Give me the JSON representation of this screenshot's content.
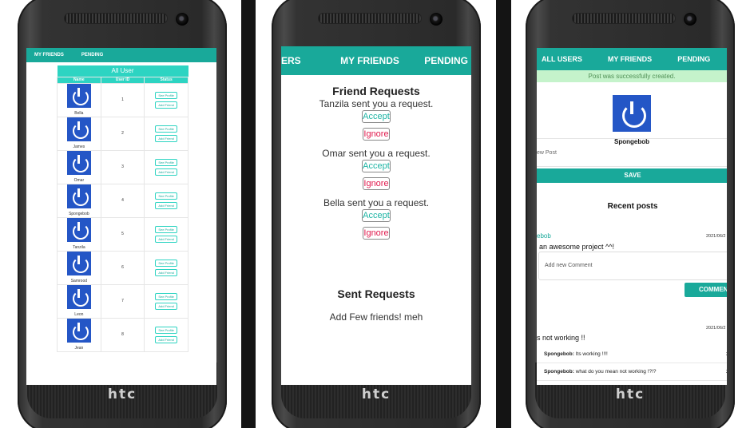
{
  "brand": "htc",
  "colors": {
    "accent": "#19a99a",
    "accent_light": "#2dd4c2",
    "avatar_blue": "#2456c6",
    "ignore_red": "#e0194c",
    "flash_green": "#c5f3cb"
  },
  "screen1": {
    "nav": [
      "MY FRIENDS",
      "PENDING"
    ],
    "table": {
      "caption": "All User",
      "headers": [
        "Name",
        "User ID",
        "Status"
      ],
      "see_profile": "See Profile",
      "add_friend": "Add Friend",
      "rows": [
        {
          "name": "Bella",
          "id": "1"
        },
        {
          "name": "James",
          "id": "2"
        },
        {
          "name": "Omar",
          "id": "3"
        },
        {
          "name": "Spongebob",
          "id": "4"
        },
        {
          "name": "Tanzila",
          "id": "5"
        },
        {
          "name": "Samrood",
          "id": "6"
        },
        {
          "name": "Leon",
          "id": "7"
        },
        {
          "name": "Jean",
          "id": "8"
        }
      ]
    }
  },
  "screen2": {
    "nav": [
      "ERS",
      "MY FRIENDS",
      "PENDING"
    ],
    "friend_requests_title": "Friend Requests",
    "accept": "Accept",
    "ignore": "Ignore",
    "requests": [
      "Tanzila sent you a request.",
      "Omar sent you a request.",
      "Bella sent you a request."
    ],
    "sent_requests_title": "Sent Requests",
    "sent_empty": "Add Few friends! meh"
  },
  "screen3": {
    "nav": [
      "ALL USERS",
      "MY FRIENDS",
      "PENDING"
    ],
    "flash": "Post was successfully created.",
    "profile_name": "Spongebob",
    "new_post_placeholder": "ew Post",
    "save": "SAVE",
    "recent_title": "Recent posts",
    "post1": {
      "author": "ebob",
      "date": "2021/06/2",
      "text": "an awesome project ^^!"
    },
    "comment_placeholder": "Add new Comment",
    "comment_button": "COMMEN",
    "post2": {
      "author": "",
      "date": "2021/06/2",
      "text": "s not working !!"
    },
    "comments": [
      {
        "author": "Spongebob:",
        "text": " Its working !!!!",
        "num": "2"
      },
      {
        "author": "Spongebob:",
        "text": " what do you mean not working !?!?",
        "num": "2"
      }
    ]
  }
}
